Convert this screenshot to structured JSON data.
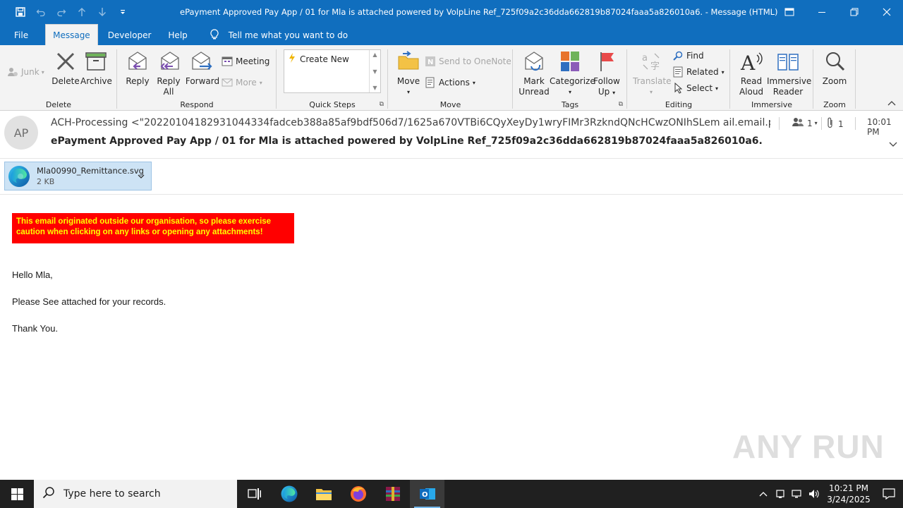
{
  "window": {
    "title": "ePayment Approved Pay App / 01 for Mla is attached  powered by VolpLine Ref_725f09a2c36dda662819b87024faaa5a826010a6.  -  Message (HTML)"
  },
  "menu_tabs": [
    "File",
    "Message",
    "Developer",
    "Help"
  ],
  "tell_me": "Tell me what you want to do",
  "ribbon": {
    "delete_group": {
      "label": "Delete",
      "junk": "Junk",
      "delete": "Delete",
      "archive": "Archive"
    },
    "respond_group": {
      "label": "Respond",
      "reply": "Reply",
      "reply_all_1": "Reply",
      "reply_all_2": "All",
      "forward": "Forward",
      "meeting": "Meeting",
      "more": "More"
    },
    "quick_steps": {
      "label": "Quick Steps",
      "create_new": "Create New"
    },
    "move_group": {
      "label": "Move",
      "move": "Move",
      "send_onenote": "Send to OneNote",
      "actions": "Actions"
    },
    "tags_group": {
      "label": "Tags",
      "mark_unread_1": "Mark",
      "mark_unread_2": "Unread",
      "categorize": "Categorize",
      "follow_up_1": "Follow",
      "follow_up_2": "Up"
    },
    "editing_group": {
      "label": "Editing",
      "translate": "Translate",
      "find": "Find",
      "related": "Related",
      "select": "Select"
    },
    "immersive_group": {
      "label": "Immersive",
      "read_aloud_1": "Read",
      "read_aloud_2": "Aloud",
      "immersive_reader_1": "Immersive",
      "immersive_reader_2": "Reader"
    },
    "zoom_group": {
      "label": "Zoom",
      "zoom": "Zoom"
    }
  },
  "message": {
    "avatar_initials": "AP",
    "from": "ACH-Processing <\"20220104182931044334fadceb388a85af9bdf506d7/1625a670VTBi6CQyXeyDy1wryFIMr3RzkndQNcHCwzONIhSLem ail.email.pandadoc.net",
    "subject": "ePayment Approved Pay App / 01 for Mla is attached  powered by VolpLine Ref_725f09a2c36dda662819b87024faaa5a826010a6.",
    "people_count": "1",
    "attachment_count": "1",
    "time": "10:01 PM"
  },
  "attachment": {
    "name": "Mla00990_Remittance.svg",
    "size": "2 KB"
  },
  "body": {
    "warning": "This email originated outside our organisation, so please exercise caution when clicking on any links or opening any attachments!",
    "greeting": "Hello Mla,",
    "line1": "Please See attached for your records.",
    "closing": "Thank You."
  },
  "watermark": "ANY RUN",
  "taskbar": {
    "search_placeholder": "Type here to search",
    "time": "10:21 PM",
    "date": "3/24/2025"
  }
}
